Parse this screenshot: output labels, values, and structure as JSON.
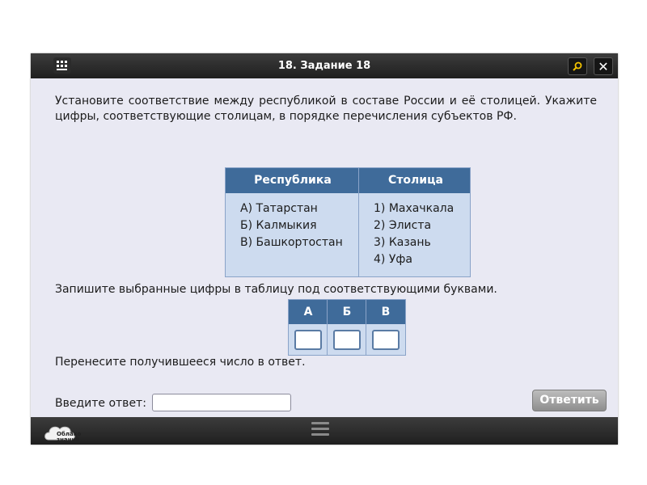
{
  "window": {
    "title": "18. Задание 18"
  },
  "question": {
    "text": "Установите соответствие между республикой в составе России и её столицей. Укажите цифры, соответствующие столицам, в порядке перечисления субъектов РФ."
  },
  "match_table": {
    "headers": [
      "Республика",
      "Столица"
    ],
    "left": [
      "А)  Татарстан",
      "Б)  Калмыкия",
      "В)  Башкортостан"
    ],
    "right": [
      "1)  Махачкала",
      "2)  Элиста",
      "3)  Казань",
      "4)  Уфа"
    ]
  },
  "instruction": "Запишите выбранные цифры в таблицу под соответствующими буквами.",
  "answer_table": {
    "headers": [
      "А",
      "Б",
      "В"
    ],
    "values": [
      "",
      "",
      ""
    ]
  },
  "transfer_instruction": "Перенесите получившееся число в ответ.",
  "entry": {
    "label": "Введите ответ:",
    "value": ""
  },
  "buttons": {
    "submit": "Ответить"
  },
  "icons": {
    "menu": "menu-grid-icon",
    "search": "search-icon",
    "close": "close-icon",
    "logo": "oblako-znaniy-logo",
    "handle": "drag-handle-icon"
  },
  "logo": {
    "text": "Облако знаний"
  },
  "colors": {
    "accent": "#3f6b9a",
    "panel": "#e9e9f3",
    "cell": "#cddbef",
    "bar": "#2a2a2a",
    "button": "#9a9a9a"
  }
}
